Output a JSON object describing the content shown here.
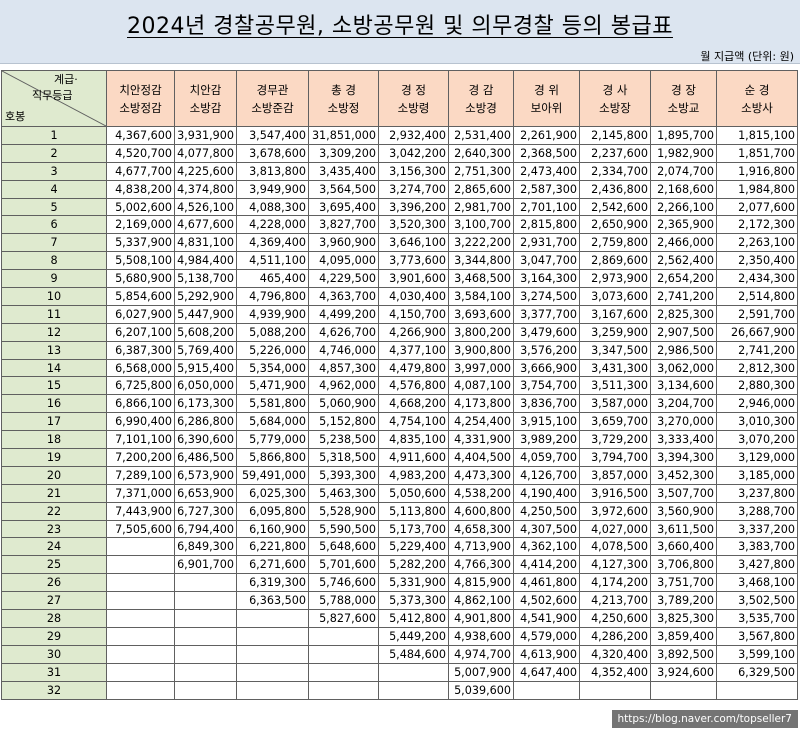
{
  "title": "2024년 경찰공무원, 소방공무원 및 의무경찰 등의 봉급표",
  "unit_note": "월 지급액 (단위: 원)",
  "corner": {
    "grade": "계급·",
    "rank_grade": "직무등급",
    "step": "호봉"
  },
  "columns": [
    {
      "line1": "치안정감",
      "line2": "소방정감"
    },
    {
      "line1": "치안감",
      "line2": "소방감"
    },
    {
      "line1": "경무관",
      "line2": "소방준감"
    },
    {
      "line1": "총 경",
      "line2": "소방정"
    },
    {
      "line1": "경 정",
      "line2": "소방령"
    },
    {
      "line1": "경 감",
      "line2": "소방경"
    },
    {
      "line1": "경 위",
      "line2": "보아위"
    },
    {
      "line1": "경 사",
      "line2": "소방장"
    },
    {
      "line1": "경 장",
      "line2": "소방교"
    },
    {
      "line1": "순 경",
      "line2": "소방사"
    }
  ],
  "rows": [
    [
      "1",
      "4,367,600",
      "3,931,900",
      "3,547,400",
      "31,851,000",
      "2,932,400",
      "2,531,400",
      "2,261,900",
      "2,145,800",
      "1,895,700",
      "1,815,100"
    ],
    [
      "2",
      "4,520,700",
      "4,077,800",
      "3,678,600",
      "3,309,200",
      "3,042,200",
      "2,640,300",
      "2,368,500",
      "2,237,600",
      "1,982,900",
      "1,851,700"
    ],
    [
      "3",
      "4,677,700",
      "4,225,600",
      "3,813,800",
      "3,435,400",
      "3,156,300",
      "2,751,300",
      "2,473,400",
      "2,334,700",
      "2,074,700",
      "1,916,800"
    ],
    [
      "4",
      "4,838,200",
      "4,374,800",
      "3,949,900",
      "3,564,500",
      "3,274,700",
      "2,865,600",
      "2,587,300",
      "2,436,800",
      "2,168,600",
      "1,984,800"
    ],
    [
      "5",
      "5,002,600",
      "4,526,100",
      "4,088,300",
      "3,695,400",
      "3,396,200",
      "2,981,700",
      "2,701,100",
      "2,542,600",
      "2,266,100",
      "2,077,600"
    ],
    [
      "6",
      "2,169,000",
      "4,677,600",
      "4,228,000",
      "3,827,700",
      "3,520,300",
      "3,100,700",
      "2,815,800",
      "2,650,900",
      "2,365,900",
      "2,172,300"
    ],
    [
      "7",
      "5,337,900",
      "4,831,100",
      "4,369,400",
      "3,960,900",
      "3,646,100",
      "3,222,200",
      "2,931,700",
      "2,759,800",
      "2,466,000",
      "2,263,100"
    ],
    [
      "8",
      "5,508,100",
      "4,984,400",
      "4,511,100",
      "4,095,000",
      "3,773,600",
      "3,344,800",
      "3,047,700",
      "2,869,600",
      "2,562,400",
      "2,350,400"
    ],
    [
      "9",
      "5,680,900",
      "5,138,700",
      "465,400",
      "4,229,500",
      "3,901,600",
      "3,468,500",
      "3,164,300",
      "2,973,900",
      "2,654,200",
      "2,434,300"
    ],
    [
      "10",
      "5,854,600",
      "5,292,900",
      "4,796,800",
      "4,363,700",
      "4,030,400",
      "3,584,100",
      "3,274,500",
      "3,073,600",
      "2,741,200",
      "2,514,800"
    ],
    [
      "11",
      "6,027,900",
      "5,447,900",
      "4,939,900",
      "4,499,200",
      "4,150,700",
      "3,693,600",
      "3,377,700",
      "3,167,600",
      "2,825,300",
      "2,591,700"
    ],
    [
      "12",
      "6,207,100",
      "5,608,200",
      "5,088,200",
      "4,626,700",
      "4,266,900",
      "3,800,200",
      "3,479,600",
      "3,259,900",
      "2,907,500",
      "26,667,900"
    ],
    [
      "13",
      "6,387,300",
      "5,769,400",
      "5,226,000",
      "4,746,000",
      "4,377,100",
      "3,900,800",
      "3,576,200",
      "3,347,500",
      "2,986,500",
      "2,741,200"
    ],
    [
      "14",
      "6,568,000",
      "5,915,400",
      "5,354,000",
      "4,857,300",
      "4,479,800",
      "3,997,000",
      "3,666,900",
      "3,431,300",
      "3,062,000",
      "2,812,300"
    ],
    [
      "15",
      "6,725,800",
      "6,050,000",
      "5,471,900",
      "4,962,000",
      "4,576,800",
      "4,087,100",
      "3,754,700",
      "3,511,300",
      "3,134,600",
      "2,880,300"
    ],
    [
      "16",
      "6,866,100",
      "6,173,300",
      "5,581,800",
      "5,060,900",
      "4,668,200",
      "4,173,800",
      "3,836,700",
      "3,587,000",
      "3,204,700",
      "2,946,000"
    ],
    [
      "17",
      "6,990,400",
      "6,286,800",
      "5,684,000",
      "5,152,800",
      "4,754,100",
      "4,254,400",
      "3,915,100",
      "3,659,700",
      "3,270,000",
      "3,010,300"
    ],
    [
      "18",
      "7,101,100",
      "6,390,600",
      "5,779,000",
      "5,238,500",
      "4,835,100",
      "4,331,900",
      "3,989,200",
      "3,729,200",
      "3,333,400",
      "3,070,200"
    ],
    [
      "19",
      "7,200,200",
      "6,486,500",
      "5,866,800",
      "5,318,500",
      "4,911,600",
      "4,404,500",
      "4,059,700",
      "3,794,700",
      "3,394,300",
      "3,129,000"
    ],
    [
      "20",
      "7,289,100",
      "6,573,900",
      "59,491,000",
      "5,393,300",
      "4,983,200",
      "4,473,300",
      "4,126,700",
      "3,857,000",
      "3,452,300",
      "3,185,000"
    ],
    [
      "21",
      "7,371,000",
      "6,653,900",
      "6,025,300",
      "5,463,300",
      "5,050,600",
      "4,538,200",
      "4,190,400",
      "3,916,500",
      "3,507,700",
      "3,237,800"
    ],
    [
      "22",
      "7,443,900",
      "6,727,300",
      "6,095,800",
      "5,528,900",
      "5,113,800",
      "4,600,800",
      "4,250,500",
      "3,972,600",
      "3,560,900",
      "3,288,700"
    ],
    [
      "23",
      "7,505,600",
      "6,794,400",
      "6,160,900",
      "5,590,500",
      "5,173,700",
      "4,658,300",
      "4,307,500",
      "4,027,000",
      "3,611,500",
      "3,337,200"
    ],
    [
      "24",
      "",
      "6,849,300",
      "6,221,800",
      "5,648,600",
      "5,229,400",
      "4,713,900",
      "4,362,100",
      "4,078,500",
      "3,660,400",
      "3,383,700"
    ],
    [
      "25",
      "",
      "6,901,700",
      "6,271,600",
      "5,701,600",
      "5,282,200",
      "4,766,300",
      "4,414,200",
      "4,127,300",
      "3,706,800",
      "3,427,800"
    ],
    [
      "26",
      "",
      "",
      "6,319,300",
      "5,746,600",
      "5,331,900",
      "4,815,900",
      "4,461,800",
      "4,174,200",
      "3,751,700",
      "3,468,100"
    ],
    [
      "27",
      "",
      "",
      "6,363,500",
      "5,788,000",
      "5,373,300",
      "4,862,100",
      "4,502,600",
      "4,213,700",
      "3,789,200",
      "3,502,500"
    ],
    [
      "28",
      "",
      "",
      "",
      "5,827,600",
      "5,412,800",
      "4,901,800",
      "4,541,900",
      "4,250,600",
      "3,825,300",
      "3,535,700"
    ],
    [
      "29",
      "",
      "",
      "",
      "",
      "5,449,200",
      "4,938,600",
      "4,579,000",
      "4,286,200",
      "3,859,400",
      "3,567,800"
    ],
    [
      "30",
      "",
      "",
      "",
      "",
      "5,484,600",
      "4,974,700",
      "4,613,900",
      "4,320,400",
      "3,892,500",
      "3,599,100"
    ],
    [
      "31",
      "",
      "",
      "",
      "",
      "",
      "5,007,900",
      "4,647,400",
      "4,352,400",
      "3,924,600",
      "6,329,500"
    ],
    [
      "32",
      "",
      "",
      "",
      "",
      "",
      "5,039,600",
      "",
      "",
      "",
      ""
    ]
  ],
  "watermark": "https://blog.naver.com/topseller7",
  "colors": {
    "header_bg": "#fbd9c4",
    "rank_bg": "#dfeacf",
    "title_bg": "#dce5f0"
  }
}
